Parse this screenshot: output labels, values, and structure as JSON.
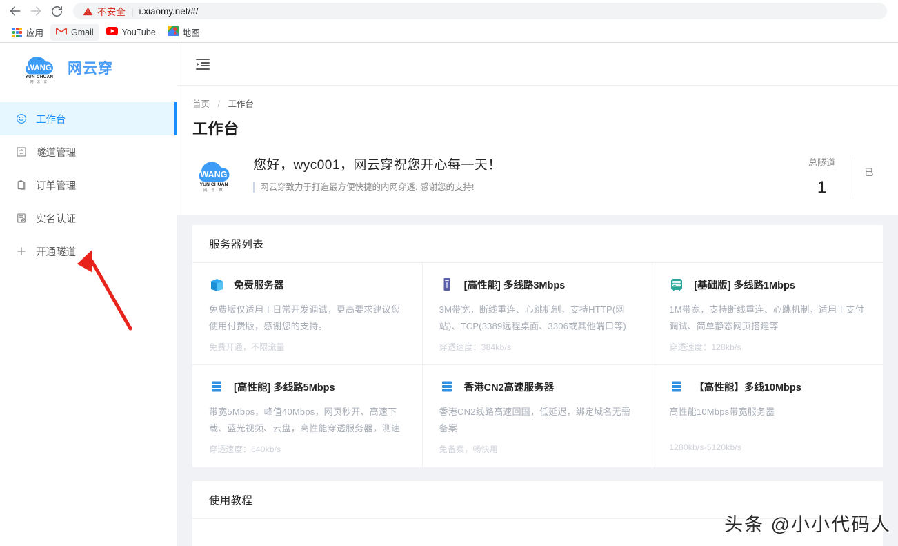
{
  "browser": {
    "back_icon": "arrow-left-icon",
    "forward_icon": "arrow-right-icon",
    "reload_icon": "reload-icon",
    "security_warning_icon": "warning-triangle-icon",
    "security_label": "不安全",
    "separator": "|",
    "url": "i.xiaomy.net/#/",
    "bookmarks": [
      {
        "label": "应用",
        "icon": "apps-grid-icon"
      },
      {
        "label": "Gmail",
        "icon": "gmail-icon"
      },
      {
        "label": "YouTube",
        "icon": "youtube-icon"
      },
      {
        "label": "地图",
        "icon": "maps-icon"
      }
    ]
  },
  "sidebar": {
    "brand_logo_icon": "wang-yun-chuan-cloud-logo",
    "brand_logo_text_main": "WANG",
    "brand_logo_text_sub": "YUN CHUAN",
    "brand_logo_text_sub2": "网 云 穿",
    "brand_name": "网云穿",
    "items": [
      {
        "label": "工作台",
        "icon": "smile-face-icon",
        "active": true
      },
      {
        "label": "隧道管理",
        "icon": "tunnel-box-icon",
        "active": false
      },
      {
        "label": "订单管理",
        "icon": "clipboard-icon",
        "active": false
      },
      {
        "label": "实名认证",
        "icon": "document-check-icon",
        "active": false
      },
      {
        "label": "开通隧道",
        "icon": "plus-icon",
        "active": false
      }
    ]
  },
  "header": {
    "fold_icon": "menu-fold-icon"
  },
  "page": {
    "breadcrumb_home": "首页",
    "breadcrumb_sep": "/",
    "breadcrumb_current": "工作台",
    "title": "工作台"
  },
  "welcome": {
    "avatar_icon": "wang-yun-chuan-cloud-logo",
    "greeting": "您好，wyc001，网云穿祝您开心每一天！",
    "subtitle": "网云穿致力于打造最方便快捷的内网穿透. 感谢您的支持!",
    "stats": [
      {
        "label": "总隧道",
        "value": "1"
      },
      {
        "label": "已",
        "value": ""
      }
    ]
  },
  "server_panel": {
    "title": "服务器列表",
    "cards": [
      {
        "icon": "blue-server-box-icon",
        "name": "免费服务器",
        "desc": "免费版仅适用于日常开发调试，更高要求建议您使用付费版，感谢您的支持。",
        "meta": "免费开通，不限流量"
      },
      {
        "icon": "purple-server-tower-icon",
        "name": "[高性能] 多线路3Mbps",
        "desc": "3M带宽，断线重连、心跳机制，支持HTTP(网站)、TCP(3389远程桌面、3306或其他端口等)",
        "meta": "穿透速度：384kb/s"
      },
      {
        "icon": "teal-server-rack-icon",
        "name": "[基础版] 多线路1Mbps",
        "desc": "1M带宽，支持断线重连、心跳机制，适用于支付调试、简单静态网页搭建等",
        "meta": "穿透速度：128kb/s"
      },
      {
        "icon": "blue-server-stack-icon",
        "name": "[高性能] 多线路5Mbps",
        "desc": "带宽5Mbps，峰值40Mbps，网页秒开、高速下载、蓝光视频、云盘，高性能穿透服务器，测速",
        "meta": "穿透速度：640kb/s"
      },
      {
        "icon": "blue-server-stack-icon",
        "name": "香港CN2高速服务器",
        "desc": "香港CN2线路高速回国，低延迟，绑定域名无需备案",
        "meta": "免备案，畅快用"
      },
      {
        "icon": "blue-server-stack-icon",
        "name": "【高性能】多线10Mbps",
        "desc": "高性能10Mbps带宽服务器",
        "meta": "1280kb/s-5120kb/s"
      }
    ]
  },
  "tutorial_panel": {
    "title": "使用教程"
  },
  "watermark": {
    "text": "头条 @小小代码人"
  },
  "colors": {
    "accent": "#1890ff",
    "active_bg": "#e6f7ff",
    "page_bg": "#f0f2f5",
    "brand_blue": "#4a9cf6",
    "insecure_red": "#d93025",
    "pointer_red": "#e8231c"
  }
}
